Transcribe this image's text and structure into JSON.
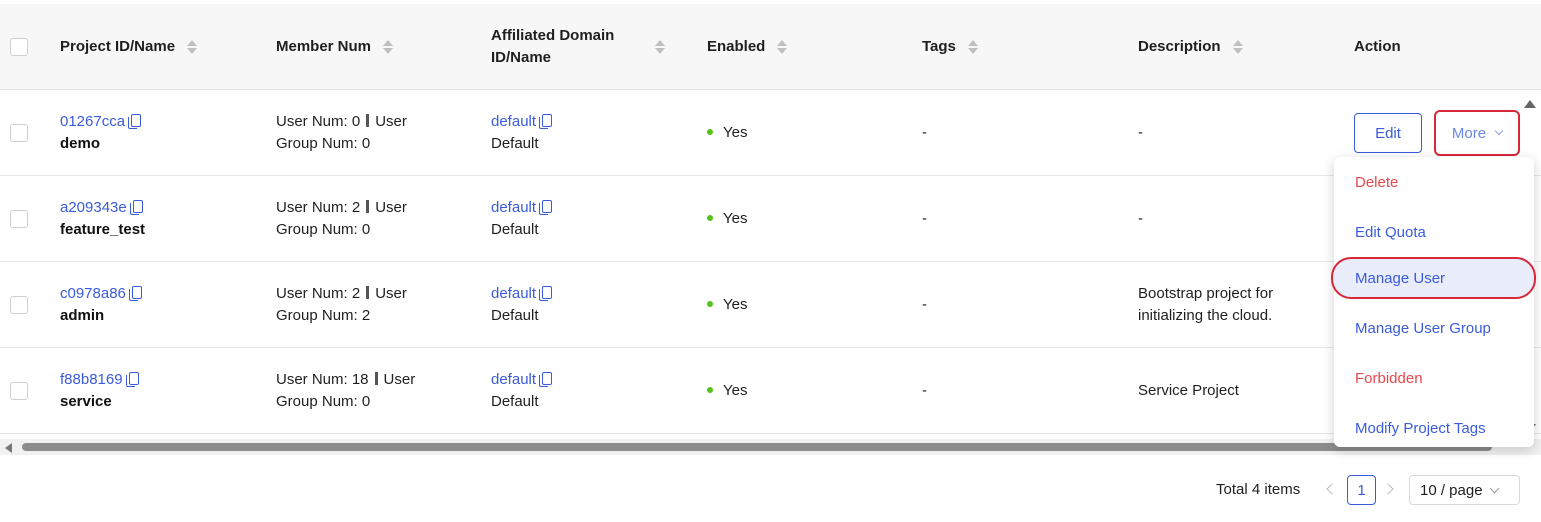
{
  "table": {
    "columns": [
      {
        "key": "project",
        "label": "Project ID/Name",
        "sortable": true
      },
      {
        "key": "member",
        "label": "Member Num",
        "sortable": true
      },
      {
        "key": "domain",
        "label": "Affiliated Domain ID/Name",
        "sortable": true
      },
      {
        "key": "enabled",
        "label": "Enabled",
        "sortable": true
      },
      {
        "key": "tags",
        "label": "Tags",
        "sortable": true
      },
      {
        "key": "description",
        "label": "Description",
        "sortable": true
      },
      {
        "key": "action",
        "label": "Action",
        "sortable": false
      }
    ],
    "rows": [
      {
        "id": "01267cca",
        "name": "demo",
        "member_line1": "User Num: 0",
        "member_line1b": "User",
        "member_line2": "Group Num: 0",
        "domain_id": "default",
        "domain_name": "Default",
        "enabled": "Yes",
        "tags": "-",
        "description_line1": "-",
        "description_line2": ""
      },
      {
        "id": "a209343e",
        "name": "feature_test",
        "member_line1": "User Num: 2",
        "member_line1b": "User",
        "member_line2": "Group Num: 0",
        "domain_id": "default",
        "domain_name": "Default",
        "enabled": "Yes",
        "tags": "-",
        "description_line1": "-",
        "description_line2": ""
      },
      {
        "id": "c0978a86",
        "name": "admin",
        "member_line1": "User Num: 2",
        "member_line1b": "User",
        "member_line2": "Group Num: 2",
        "domain_id": "default",
        "domain_name": "Default",
        "enabled": "Yes",
        "tags": "-",
        "description_line1": "Bootstrap project for",
        "description_line2": "initializing the cloud."
      },
      {
        "id": "f88b8169",
        "name": "service",
        "member_line1": "User Num: 18",
        "member_line1b": "User",
        "member_line2": "Group Num: 0",
        "domain_id": "default",
        "domain_name": "Default",
        "enabled": "Yes",
        "tags": "-",
        "description_line1": "Service Project",
        "description_line2": ""
      }
    ],
    "domain_header_line1": "Affiliated Domain",
    "domain_header_line2": "ID/Name"
  },
  "actions": {
    "edit_label": "Edit",
    "more_label": "More"
  },
  "dropdown": {
    "items": [
      {
        "label": "Delete",
        "tone": "danger"
      },
      {
        "label": "Edit Quota",
        "tone": "primary"
      },
      {
        "label": "Manage User",
        "tone": "primary",
        "highlighted": true
      },
      {
        "label": "Manage User Group",
        "tone": "primary"
      },
      {
        "label": "Forbidden",
        "tone": "danger"
      },
      {
        "label": "Modify Project Tags",
        "tone": "primary"
      }
    ]
  },
  "pagination": {
    "total": "Total 4 items",
    "current_page": "1",
    "page_size": "10 / page"
  },
  "colors": {
    "primary": "#3a5bdc",
    "danger": "#e5484d",
    "success": "#52c41a",
    "highlight_outline": "#d62839"
  }
}
